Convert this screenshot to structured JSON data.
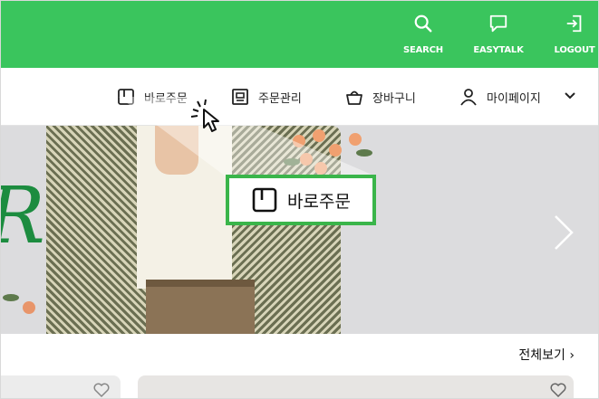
{
  "colors": {
    "brand_green": "#3ac55d",
    "callout_border": "#3ab54a"
  },
  "header": {
    "actions": [
      {
        "label": "SEARCH",
        "icon": "search-icon"
      },
      {
        "label": "EASYTALK",
        "icon": "chat-bubble-icon"
      },
      {
        "label": "LOGOUT",
        "icon": "logout-icon"
      }
    ]
  },
  "nav": {
    "items": [
      {
        "label": "바로주문",
        "icon": "quick-order-icon"
      },
      {
        "label": "주문관리",
        "icon": "order-list-icon"
      },
      {
        "label": "장바구니",
        "icon": "basket-icon"
      },
      {
        "label": "마이페이지",
        "icon": "user-icon"
      }
    ],
    "dropdown_icon": "chevron-down-icon"
  },
  "callout": {
    "label": "바로주문",
    "icon": "quick-order-icon"
  },
  "section": {
    "view_all": "전체보기 ›"
  }
}
